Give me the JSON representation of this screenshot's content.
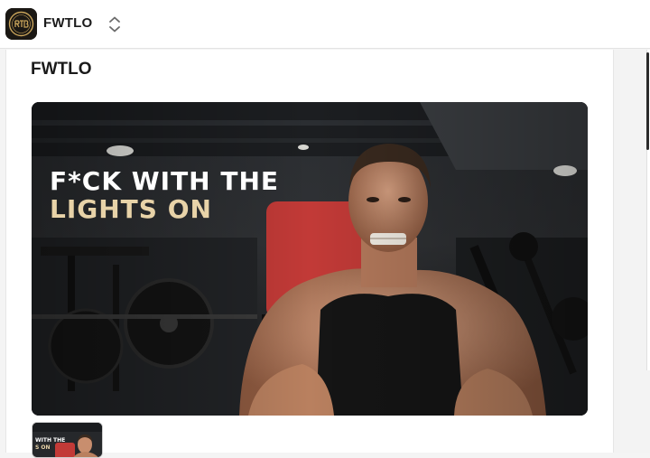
{
  "header": {
    "logo_icon": "rtb-logo-icon",
    "title": "FWTLO",
    "switcher_icon": "chevron-up-down-icon"
  },
  "page": {
    "title": "FWTLO"
  },
  "hero": {
    "line1": "F*CK WITH THE",
    "line2": "LIGHTS ON"
  },
  "thumbnail": {
    "line1": "WITH THE",
    "line2": "S ON"
  },
  "colors": {
    "accent_text": "#e8d3a8",
    "logo_gold": "#c9a45a"
  }
}
